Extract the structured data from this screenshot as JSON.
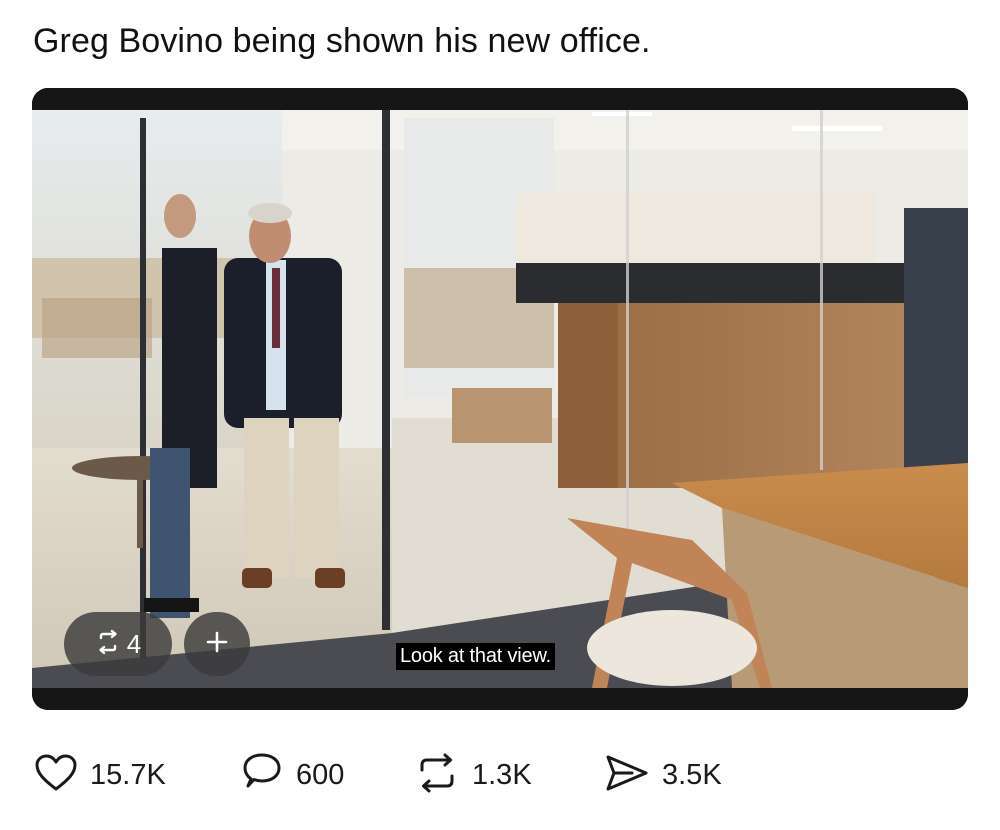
{
  "post": {
    "text": "Greg Bovino being shown his new office."
  },
  "media": {
    "subtitle": "Look at that view.",
    "overlay": {
      "repost_icon": "repost-icon",
      "repost_count": "4",
      "add_icon": "plus-icon"
    }
  },
  "actions": {
    "like": {
      "icon": "heart-icon",
      "count": "15.7K"
    },
    "reply": {
      "icon": "comment-icon",
      "count": "600"
    },
    "repost": {
      "icon": "repost-icon",
      "count": "1.3K"
    },
    "share": {
      "icon": "send-icon",
      "count": "3.5K"
    }
  },
  "colors": {
    "text": "#111111",
    "media_frame": "#161616",
    "overlay_pill": "#3c3c3c"
  }
}
